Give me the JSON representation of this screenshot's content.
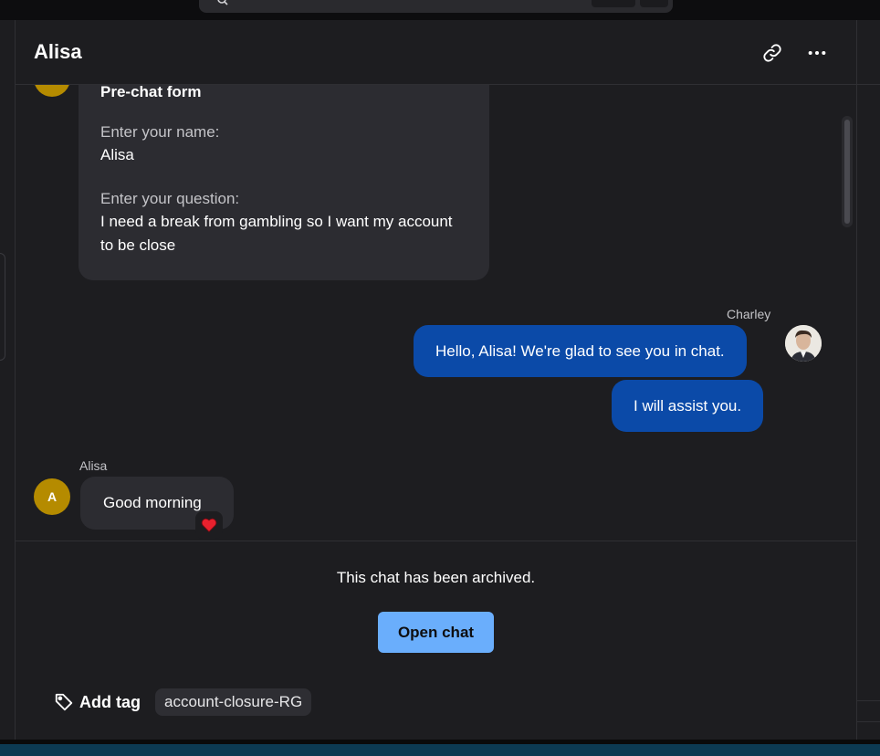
{
  "header": {
    "title": "Alisa",
    "link_icon": "link-icon",
    "more_icon": "more-horizontal-icon"
  },
  "pre_chat_form": {
    "title": "Pre-chat form",
    "name_label": "Enter your name:",
    "name_value": "Alisa",
    "question_label": "Enter your question:",
    "question_value": "I need a break from gambling so I want my account to be close"
  },
  "agent": {
    "name": "Charley",
    "messages": [
      "Hello, Alisa! We're glad to see you in chat.",
      "I will assist you."
    ],
    "bubble_color": "#0b4aa8"
  },
  "visitor": {
    "name": "Alisa",
    "initial": "A",
    "avatar_color": "#b58b00",
    "message": "Good morning",
    "reaction_icon": "heart-icon"
  },
  "archived": {
    "note": "This chat has been archived.",
    "open_button": "Open chat",
    "button_color": "#6aaefc"
  },
  "tags": {
    "add_label": "Add tag",
    "items": [
      "account-closure-RG"
    ]
  }
}
